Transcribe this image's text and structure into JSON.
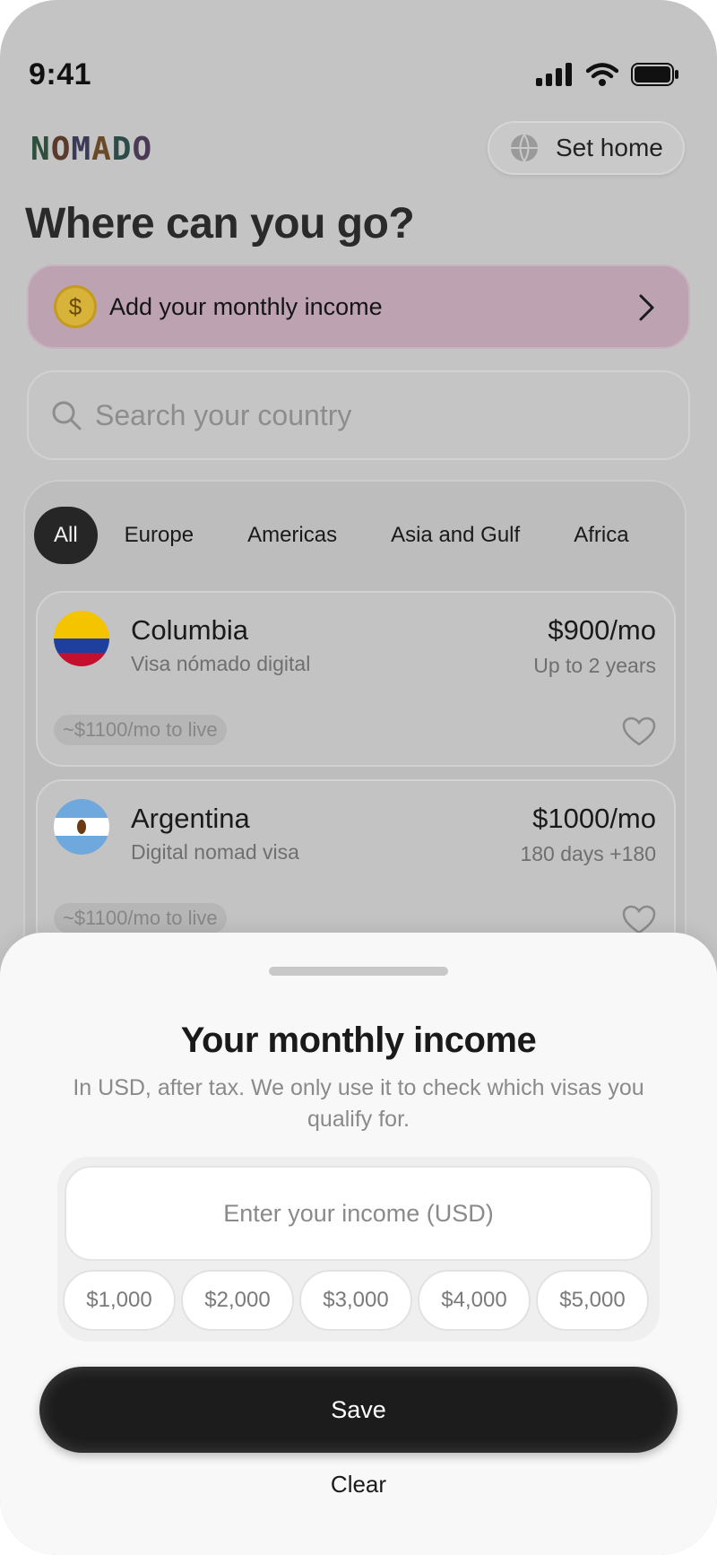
{
  "status_bar": {
    "time": "9:41"
  },
  "header": {
    "logo_letters": [
      "N",
      "O",
      "M",
      "A",
      "D",
      "O"
    ],
    "set_home_label": "Set home",
    "title": "Where can you go?"
  },
  "income_banner": {
    "icon": "dollar-coin-icon",
    "coin_glyph": "$",
    "label": "Add your monthly income"
  },
  "search": {
    "placeholder": "Search your country",
    "value": ""
  },
  "filters": {
    "items": [
      {
        "label": "All",
        "active": true
      },
      {
        "label": "Europe",
        "active": false
      },
      {
        "label": "Americas",
        "active": false
      },
      {
        "label": "Asia and Gulf",
        "active": false
      },
      {
        "label": "Africa",
        "active": false
      }
    ]
  },
  "countries": [
    {
      "name": "Columbia",
      "visa": "Visa nómado digital",
      "price": "$900/mo",
      "duration": "Up to 2 years",
      "cost_of_living": "~$1100/mo to live",
      "flag_colors": [
        "#f4c400",
        "#1f3f9e",
        "#c4102e"
      ]
    },
    {
      "name": "Argentina",
      "visa": "Digital nomad visa",
      "price": "$1000/mo",
      "duration": "180 days +180",
      "cost_of_living": "~$1100/mo to live",
      "flag_colors": [
        "#6fa8dc",
        "#ffffff",
        "#6fa8dc"
      ]
    }
  ],
  "sheet": {
    "title": "Your monthly income",
    "subtitle": "In USD, after tax. We only use it to check which visas you qualify for.",
    "input_placeholder": "Enter your income (USD)",
    "input_value": "",
    "presets": [
      "$1,000",
      "$2,000",
      "$3,000",
      "$4,000",
      "$5,000"
    ],
    "save_label": "Save",
    "clear_label": "Clear"
  }
}
